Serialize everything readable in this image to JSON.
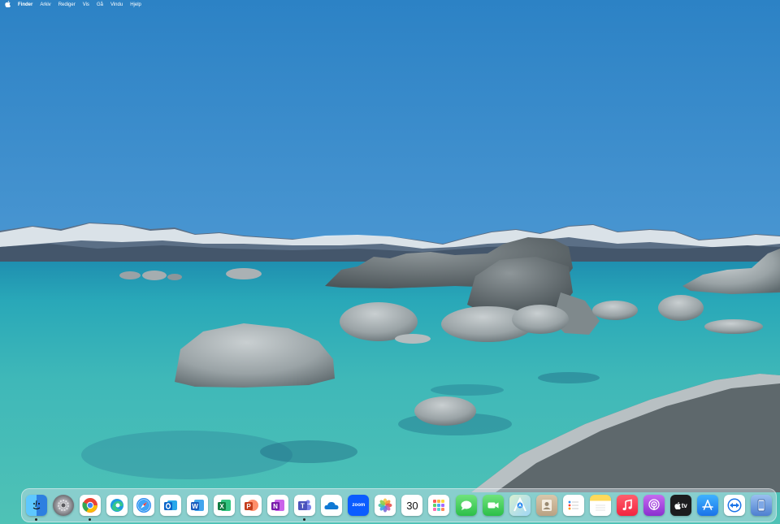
{
  "menubar": {
    "apple_icon": "apple-logo-icon",
    "app_name": "Finder",
    "items": [
      "Arkiv",
      "Rediger",
      "Vis",
      "Gå",
      "Vindu",
      "Hjelp"
    ]
  },
  "calendar": {
    "month": "",
    "day": "30"
  },
  "dock": {
    "apps": [
      {
        "icon": "finder-icon",
        "color": "#2f8cf0",
        "running": true
      },
      {
        "icon": "system-settings-icon",
        "color": "#8e8e93",
        "running": false
      },
      {
        "icon": "chrome-icon",
        "color": "#ffffff",
        "running": true
      },
      {
        "icon": "edge-icon",
        "color": "#ffffff",
        "running": false
      },
      {
        "icon": "safari-icon",
        "color": "#ffffff",
        "running": false
      },
      {
        "icon": "outlook-icon",
        "color": "#ffffff",
        "running": false
      },
      {
        "icon": "word-icon",
        "color": "#ffffff",
        "running": false
      },
      {
        "icon": "excel-icon",
        "color": "#ffffff",
        "running": false
      },
      {
        "icon": "powerpoint-icon",
        "color": "#ffffff",
        "running": false
      },
      {
        "icon": "onenote-icon",
        "color": "#ffffff",
        "running": false
      },
      {
        "icon": "teams-icon",
        "color": "#ffffff",
        "running": true
      },
      {
        "icon": "onedrive-icon",
        "color": "#ffffff",
        "running": false
      },
      {
        "icon": "zoom-icon",
        "color": "#0b5cff",
        "label": "zoom",
        "running": false
      },
      {
        "icon": "photos-icon",
        "color": "#ffffff",
        "running": false
      },
      {
        "icon": "calendar-icon",
        "color": "#ffffff",
        "running": false
      },
      {
        "icon": "launchpad-icon",
        "color": "#ffffff",
        "running": false
      },
      {
        "icon": "messages-icon",
        "color": "#34c759",
        "running": false
      },
      {
        "icon": "facetime-icon",
        "color": "#34c759",
        "running": false
      },
      {
        "icon": "maps-icon",
        "color": "#ffffff",
        "running": false
      },
      {
        "icon": "contacts-icon",
        "color": "#c9b79c",
        "running": false
      },
      {
        "icon": "reminders-icon",
        "color": "#ffffff",
        "running": false
      },
      {
        "icon": "notes-icon",
        "color": "#ffffff",
        "running": false
      },
      {
        "icon": "music-icon",
        "color": "#fa2d48",
        "running": false
      },
      {
        "icon": "podcasts-icon",
        "color": "#9b45d6",
        "running": false
      },
      {
        "icon": "apple-tv-icon",
        "color": "#1c1c1e",
        "label": "tv",
        "running": false
      },
      {
        "icon": "app-store-icon",
        "color": "#1e88f5",
        "running": false
      },
      {
        "icon": "teamviewer-icon",
        "color": "#1a73e8",
        "running": false
      },
      {
        "icon": "simulator-icon",
        "color": "#5b8fd8",
        "running": false
      }
    ]
  }
}
